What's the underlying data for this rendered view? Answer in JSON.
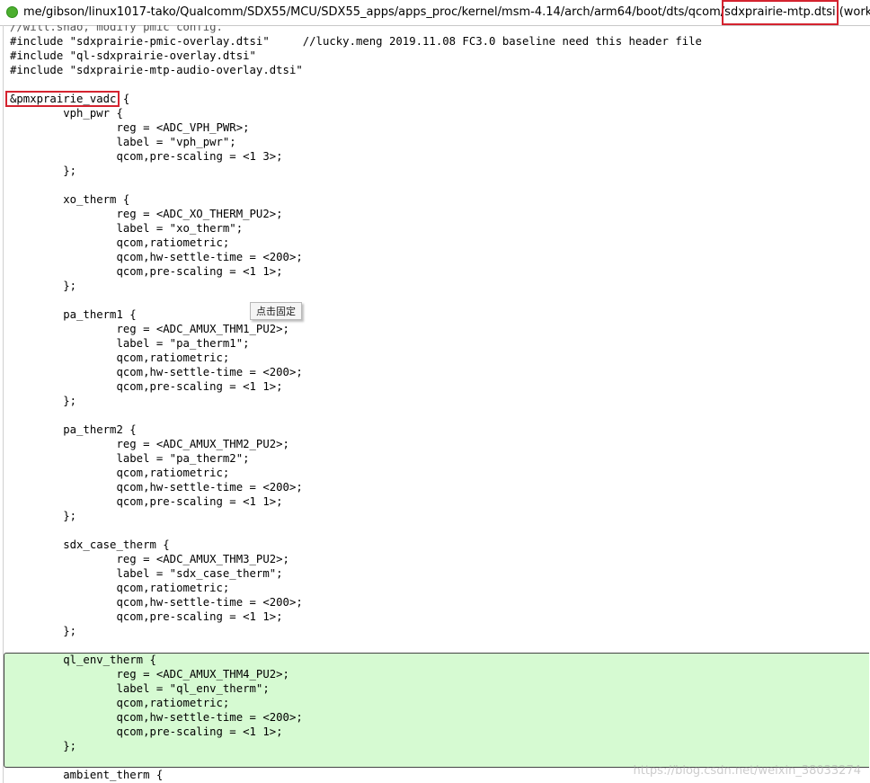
{
  "titlebar": {
    "status_icon": "green-dot-icon",
    "path_prefix": "me/gibson/linux1017-tako/Qualcomm/SDX55/MCU/SDX55_apps/apps_proc/kernel/msm-4.14/arch/arm64/boot/dts/qcom/",
    "file_name": "sdxprairie-mtp.dtsi",
    "suffix": " (workspace file)"
  },
  "colors": {
    "highlight_box": "#d4232f",
    "changed_block_bg": "#d6fad2",
    "status_dot": "#4caf2f"
  },
  "tooltip": "点击固定",
  "watermark": "https://blog.csdn.net/weixin_38033274",
  "code": {
    "lines": [
      "//will.shao, modify pmic config.",
      "#include \"sdxprairie-pmic-overlay.dtsi\"     //lucky.meng 2019.11.08 FC3.0 baseline need this header file",
      "#include \"ql-sdxprairie-overlay.dtsi\"",
      "#include \"sdxprairie-mtp-audio-overlay.dtsi\"",
      "",
      "&pmxprairie_vadc {",
      "        vph_pwr {",
      "                reg = <ADC_VPH_PWR>;",
      "                label = \"vph_pwr\";",
      "                qcom,pre-scaling = <1 3>;",
      "        };",
      "",
      "        xo_therm {",
      "                reg = <ADC_XO_THERM_PU2>;",
      "                label = \"xo_therm\";",
      "                qcom,ratiometric;",
      "                qcom,hw-settle-time = <200>;",
      "                qcom,pre-scaling = <1 1>;",
      "        };",
      "",
      "        pa_therm1 {",
      "                reg = <ADC_AMUX_THM1_PU2>;",
      "                label = \"pa_therm1\";",
      "                qcom,ratiometric;",
      "                qcom,hw-settle-time = <200>;",
      "                qcom,pre-scaling = <1 1>;",
      "        };",
      "",
      "        pa_therm2 {",
      "                reg = <ADC_AMUX_THM2_PU2>;",
      "                label = \"pa_therm2\";",
      "                qcom,ratiometric;",
      "                qcom,hw-settle-time = <200>;",
      "                qcom,pre-scaling = <1 1>;",
      "        };",
      "",
      "        sdx_case_therm {",
      "                reg = <ADC_AMUX_THM3_PU2>;",
      "                label = \"sdx_case_therm\";",
      "                qcom,ratiometric;",
      "                qcom,hw-settle-time = <200>;",
      "                qcom,pre-scaling = <1 1>;",
      "        };",
      "",
      "        ql_env_therm {",
      "                reg = <ADC_AMUX_THM4_PU2>;",
      "                label = \"ql_env_therm\";",
      "                qcom,ratiometric;",
      "                qcom,hw-settle-time = <200>;",
      "                qcom,pre-scaling = <1 1>;",
      "        };",
      "",
      "        ambient_therm {"
    ]
  }
}
